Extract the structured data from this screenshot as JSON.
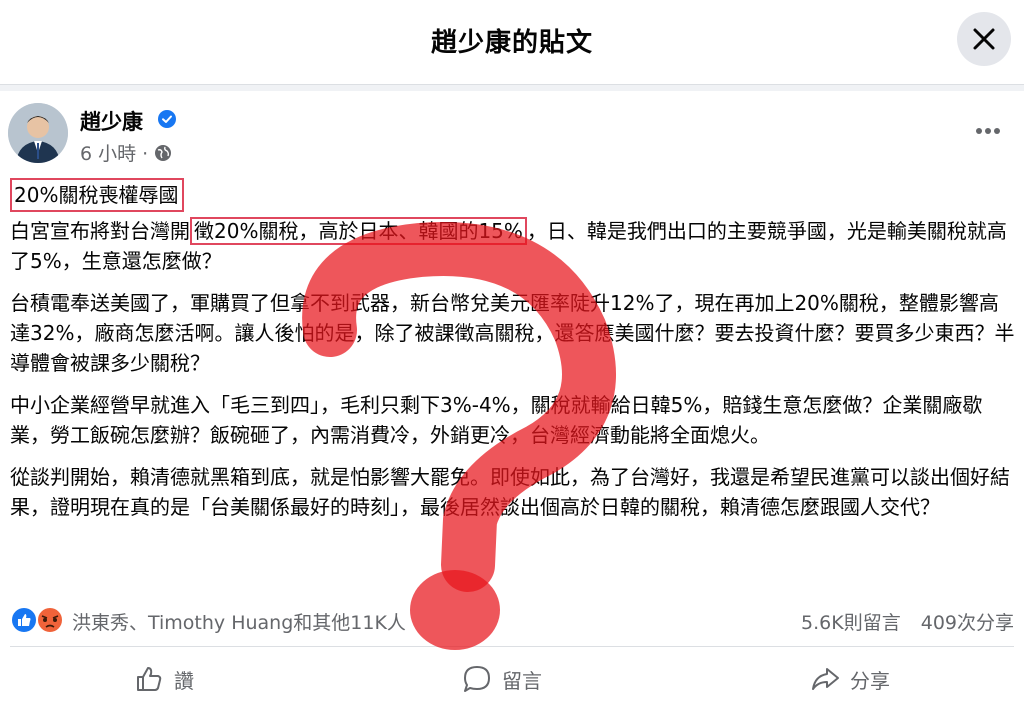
{
  "header": {
    "title": "趙少康的貼文",
    "close_icon": "close-icon"
  },
  "post": {
    "author": "趙少康",
    "verified_icon": "verified-badge-icon",
    "time": "6 小時 ·",
    "privacy_icon": "globe-icon",
    "more_icon": "more-horizontal-icon",
    "headline": "20%關稅喪權辱國",
    "p1_a": "白宮宣布將對台灣開",
    "p1_hl": "徵20%關稅，高於日本、韓國的15%",
    "p1_b": "，日、韓是我們出口的主要競爭國，光是輸美關稅就高了5%，生意還怎麼做？",
    "p2": "台積電奉送美國了，軍購買了但拿不到武器，新台幣兌美元匯率陡升12%了，現在再加上20%關稅，整體影響高達32%，廠商怎麼活啊。讓人後怕的是，除了被課徵高關稅，還答應美國什麼？要去投資什麼？要買多少東西？半導體會被課多少關稅？",
    "p3": "中小企業經營早就進入「毛三到四」，毛利只剩下3%-4%，關稅就輸給日韓5%，賠錢生意怎麼做？企業關廠歇業，勞工飯碗怎麼辦？飯碗砸了，內需消費冷，外銷更冷，台灣經濟動能將全面熄火。",
    "p4": "從談判開始，賴清德就黑箱到底，就是怕影響大罷免。即使如此，為了台灣好，我還是希望民進黨可以談出個好結果，證明現在真的是「台美關係最好的時刻」，最後居然談出個高於日韓的關稅，賴清德怎麼跟國人交代？"
  },
  "reactions": {
    "icons": [
      "like-reaction-icon",
      "angry-reaction-icon"
    ],
    "names": "洪東秀、Timothy Huang和其他11K人",
    "comments": "5.6K則留言",
    "shares": "409次分享"
  },
  "actions": {
    "like": "讚",
    "comment": "留言",
    "share": "分享"
  },
  "colors": {
    "accent_blue": "#1877f2",
    "annotation_red": "#e0475e",
    "overlay_question_red": "#e8151c",
    "muted_text": "#65676b"
  }
}
